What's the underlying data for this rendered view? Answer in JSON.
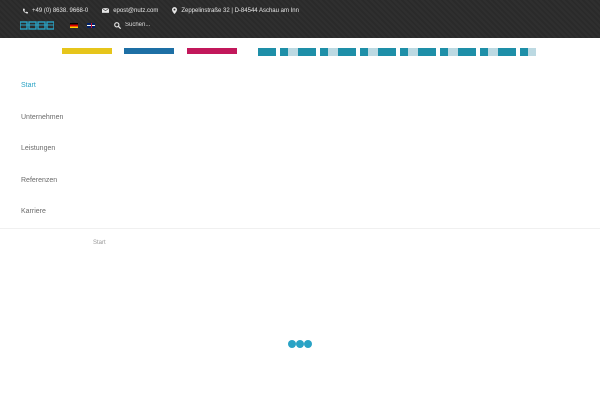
{
  "topbar": {
    "phone": "+49 (0) 8638. 9668-0",
    "email": "epost@nutz.com",
    "address": "Zeppelinstraße 32 | D-84544 Aschau am Inn",
    "search_placeholder": "Suchen..."
  },
  "nav": {
    "items": [
      {
        "label": "Start",
        "active": true
      },
      {
        "label": "Unternehmen",
        "active": false
      },
      {
        "label": "Leistungen",
        "active": false
      },
      {
        "label": "Referenzen",
        "active": false
      },
      {
        "label": "Karriere",
        "active": false
      }
    ]
  },
  "breadcrumb": "Start",
  "colors": {
    "accent": "#2aa3c5",
    "topbar_bg": "#2b2b2b",
    "brand_yellow": "#e6c51b",
    "brand_blue": "#1d6fa5",
    "brand_magenta": "#c2185b",
    "brand_teal": "#1e8fa8"
  },
  "icons": [
    "phone-icon",
    "mail-icon",
    "location-icon",
    "flag-de-icon",
    "flag-en-icon",
    "search-icon"
  ]
}
